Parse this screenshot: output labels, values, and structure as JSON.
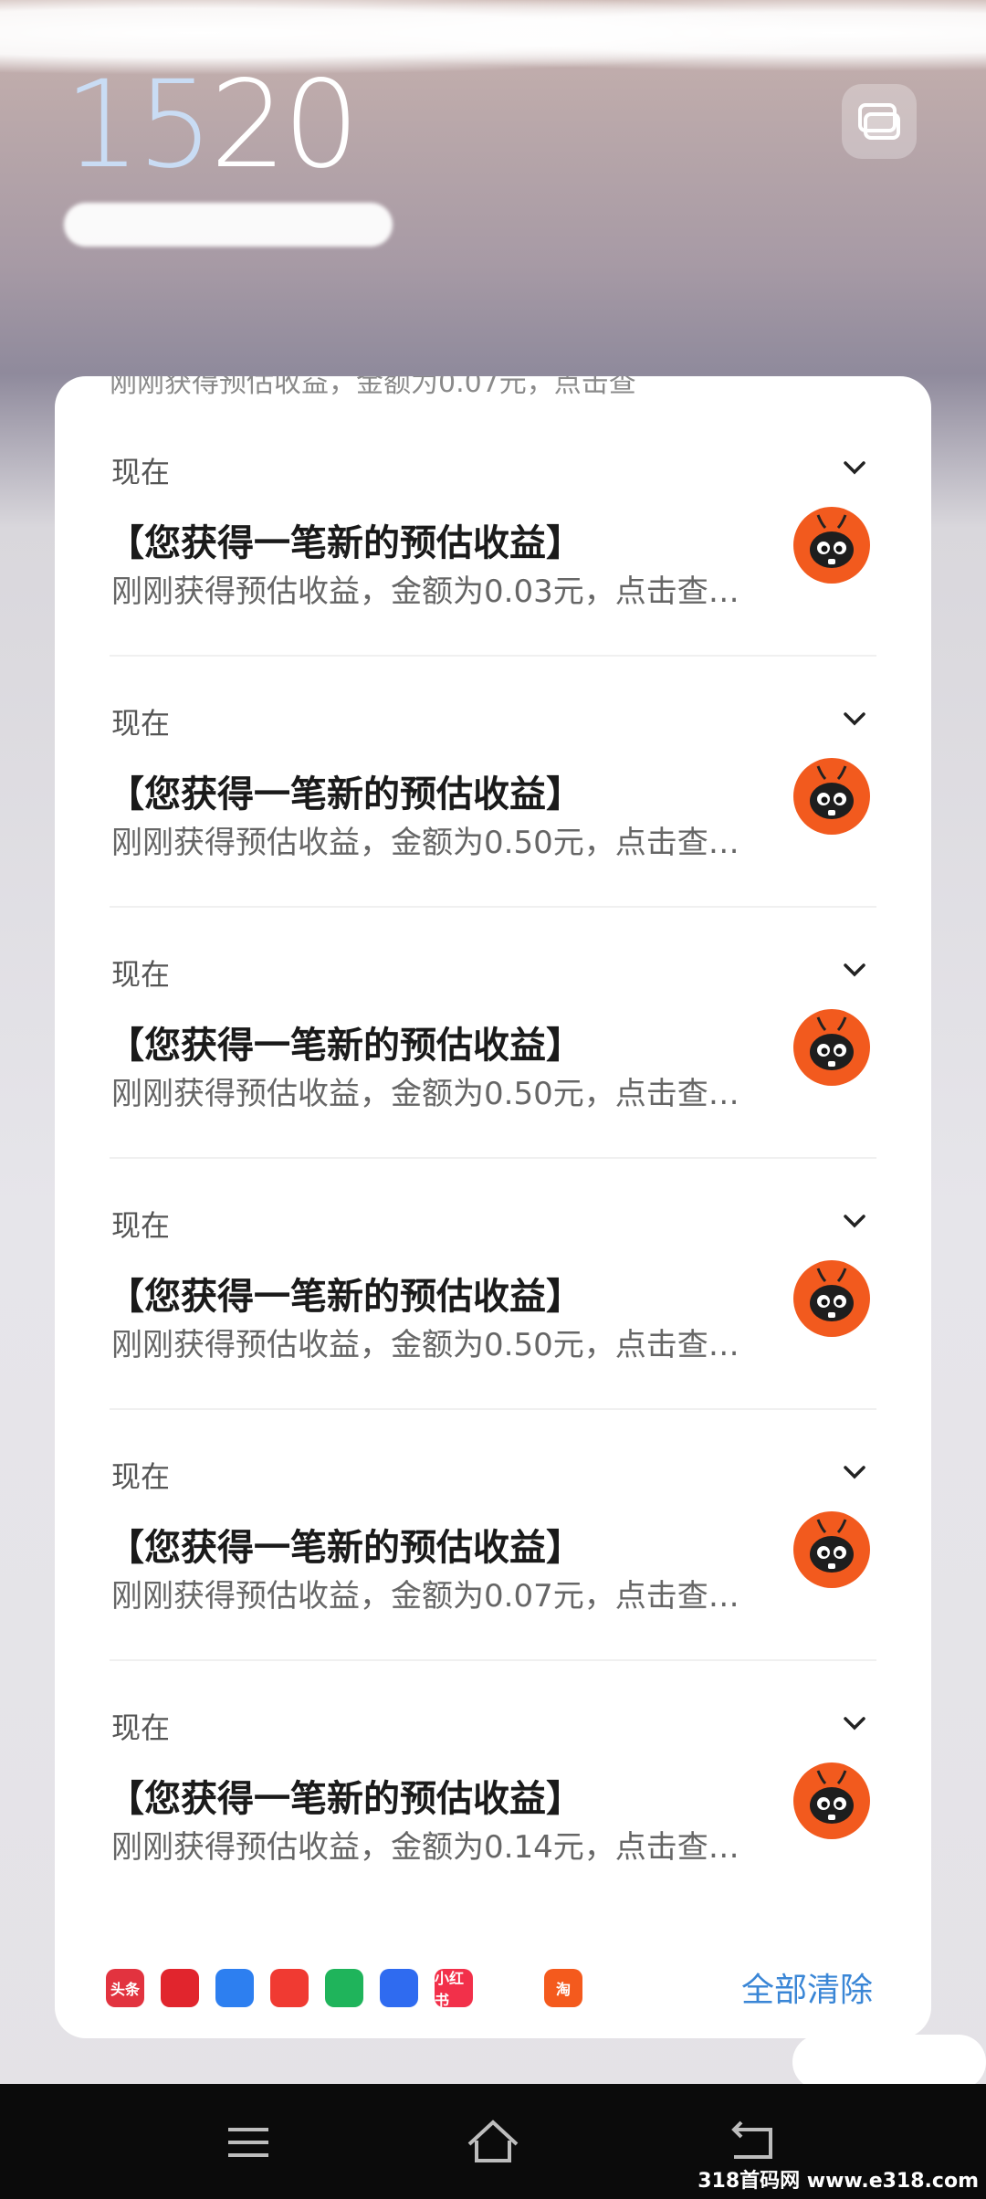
{
  "lockscreen": {
    "hour": "15",
    "minute": "20"
  },
  "panel": {
    "peek_text": "刚刚获得预估收益，金额为0.07元，点击查"
  },
  "notifications": [
    {
      "time": "现在",
      "title": "【您获得一笔新的预估收益】",
      "body": "刚刚获得预估收益，金额为0.03元，点击查…"
    },
    {
      "time": "现在",
      "title": "【您获得一笔新的预估收益】",
      "body": "刚刚获得预估收益，金额为0.50元，点击查…"
    },
    {
      "time": "现在",
      "title": "【您获得一笔新的预估收益】",
      "body": "刚刚获得预估收益，金额为0.50元，点击查…"
    },
    {
      "time": "现在",
      "title": "【您获得一笔新的预估收益】",
      "body": "刚刚获得预估收益，金额为0.50元，点击查…"
    },
    {
      "time": "现在",
      "title": "【您获得一笔新的预估收益】",
      "body": "刚刚获得预估收益，金额为0.07元，点击查…"
    },
    {
      "time": "现在",
      "title": "【您获得一笔新的预估收益】",
      "body": "刚刚获得预估收益，金额为0.14元，点击查…"
    }
  ],
  "dock_apps": [
    {
      "name": "头条",
      "color": "#e2333f"
    },
    {
      "name": "",
      "color": "#e1252d"
    },
    {
      "name": "",
      "color": "#2d7ff0"
    },
    {
      "name": "",
      "color": "#f03a32"
    },
    {
      "name": "",
      "color": "#1fb45b"
    },
    {
      "name": "",
      "color": "#2f6bf0"
    },
    {
      "name": "小红书",
      "color": "#f2304a"
    },
    {
      "name": "",
      "color": "#ffffff"
    },
    {
      "name": "淘",
      "color": "#f45a1d"
    }
  ],
  "clear_all": "全部清除",
  "watermark": "318首码网 www.e318.com",
  "colors": {
    "accent": "#3a86d6",
    "avatar": "#f25a1e"
  }
}
